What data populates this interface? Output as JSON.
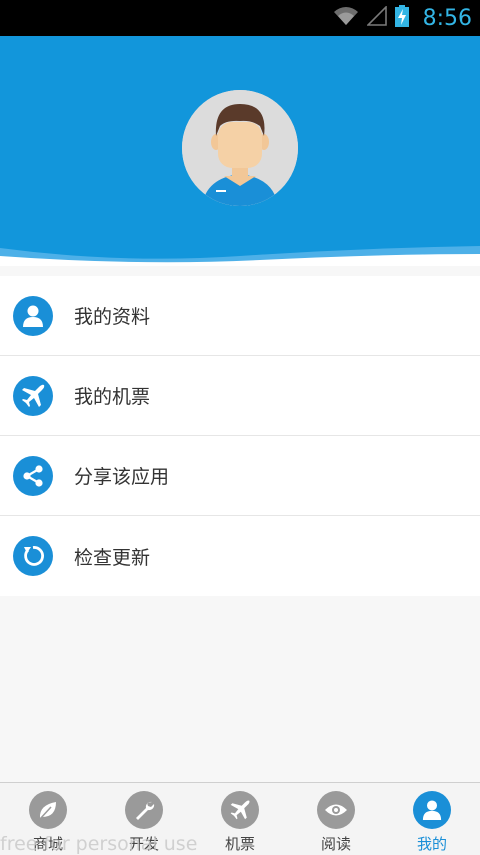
{
  "status_bar": {
    "time": "8:56",
    "icons": [
      "wifi-icon",
      "signal-icon",
      "battery-charging-icon"
    ]
  },
  "header": {
    "background": "#1296db",
    "avatar": "user-avatar"
  },
  "menu": {
    "items": [
      {
        "label": "我的资料",
        "icon": "person-icon"
      },
      {
        "label": "我的机票",
        "icon": "airplane-icon"
      },
      {
        "label": "分享该应用",
        "icon": "share-icon"
      },
      {
        "label": "检查更新",
        "icon": "refresh-icon"
      }
    ]
  },
  "tabbar": {
    "tabs": [
      {
        "label": "商城",
        "icon": "leaf-icon",
        "active": false
      },
      {
        "label": "开发",
        "icon": "wrench-icon",
        "active": false
      },
      {
        "label": "机票",
        "icon": "airplane-icon",
        "active": false
      },
      {
        "label": "阅读",
        "icon": "eye-icon",
        "active": false
      },
      {
        "label": "我的",
        "icon": "person-icon",
        "active": true
      }
    ],
    "active_color": "#1a8fd7"
  },
  "watermark": "free for personal use"
}
